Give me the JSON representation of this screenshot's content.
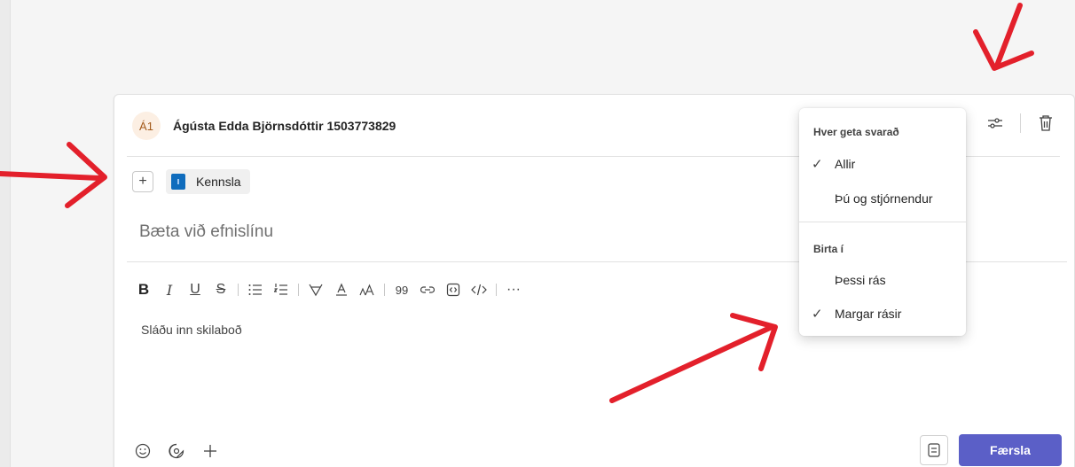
{
  "post": {
    "avatar_initials": "Á1",
    "author": "Ágústa Edda Björnsdóttir 1503773829",
    "channel_tag": "Kennsla",
    "subject_placeholder": "Bæta við efnislínu",
    "body_placeholder": "Sláðu inn skilaboð",
    "post_button": "Færsla"
  },
  "toolbar": {
    "bold": "B",
    "italic": "I",
    "underline": "U",
    "strike": "S",
    "quote": "99",
    "more": "···"
  },
  "popup": {
    "reply_heading": "Hver geta svarað",
    "reply_options": [
      "Allir",
      "Þú og stjórnendur"
    ],
    "reply_selected": "Allir",
    "post_heading": "Birta í",
    "post_options": [
      "Þessi rás",
      "Margar rásir"
    ],
    "post_selected": "Margar rásir"
  },
  "icons": {
    "header": [
      "settings-sliders-icon",
      "trash-icon"
    ],
    "bottom": [
      "emoji-icon",
      "sticker-icon",
      "add-icon"
    ],
    "format": "format-icon"
  },
  "colors": {
    "accent": "#5b5fc7",
    "annotation_arrows": "#e3202b",
    "channel_icon": "#0f6cbd"
  }
}
